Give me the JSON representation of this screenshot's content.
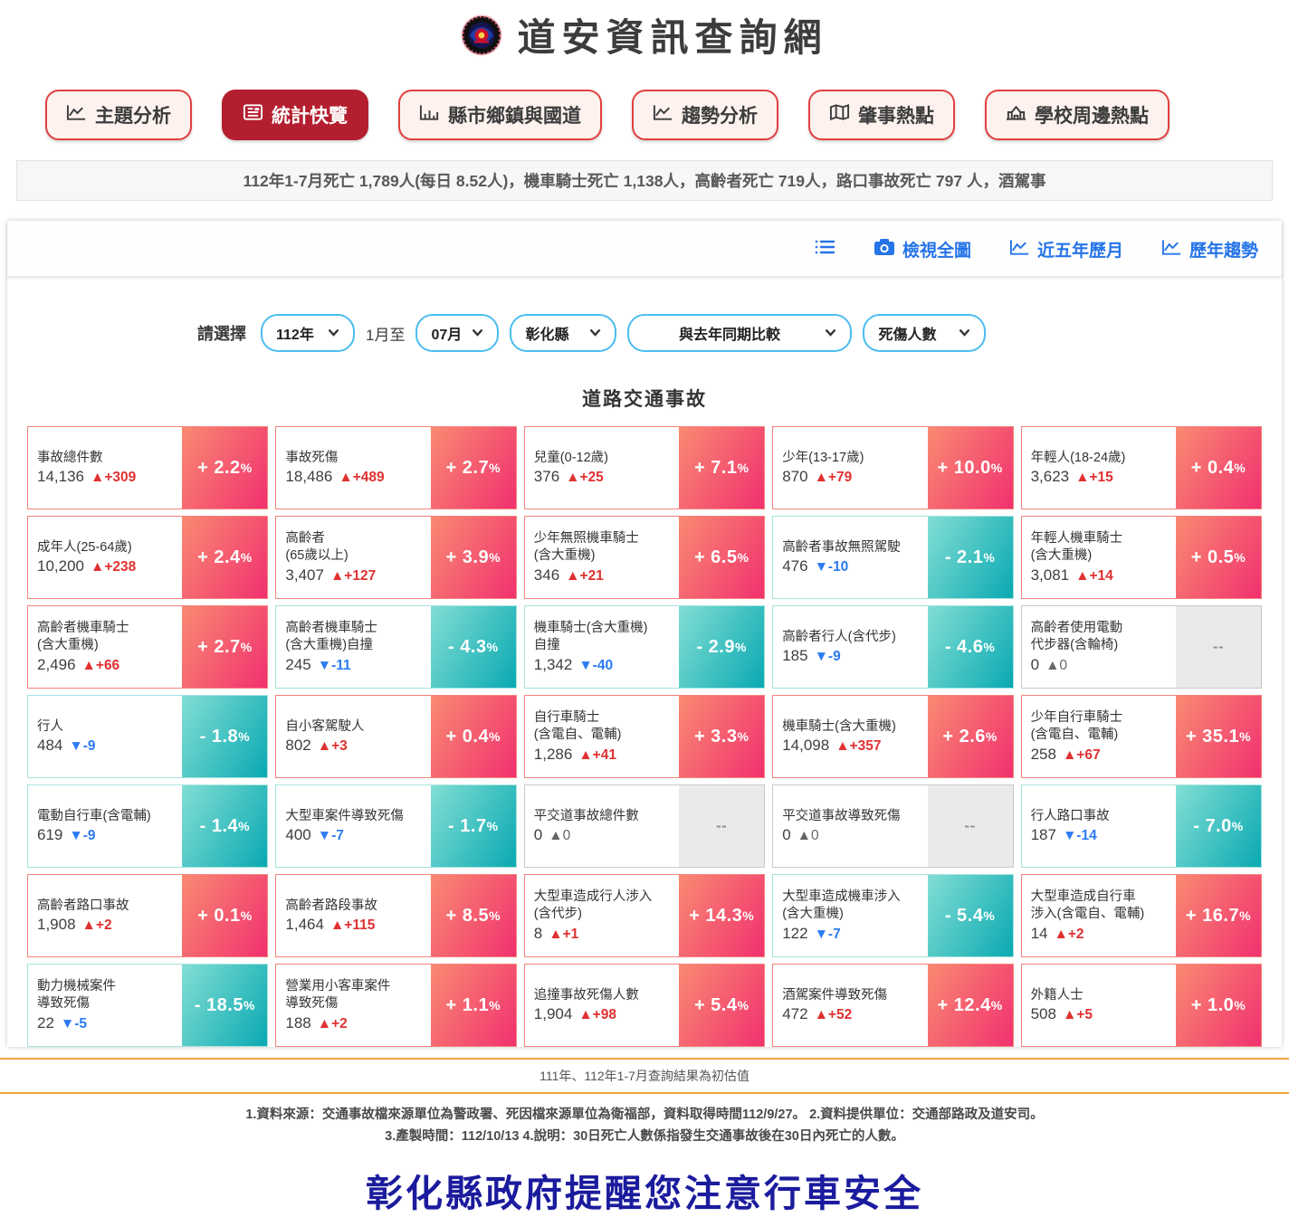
{
  "header": {
    "title": "道安資訊查詢網",
    "logo": "motc-emblem"
  },
  "nav": {
    "items": [
      {
        "label": "主題分析",
        "icon": "area-chart-icon",
        "active": false
      },
      {
        "label": "統計快覽",
        "icon": "newspaper-icon",
        "active": true
      },
      {
        "label": "縣市鄉鎮與國道",
        "icon": "bar-chart-icon",
        "active": false
      },
      {
        "label": "趨勢分析",
        "icon": "area-chart-icon",
        "active": false
      },
      {
        "label": "肇事熱點",
        "icon": "map-icon",
        "active": false
      },
      {
        "label": "學校周邊熱點",
        "icon": "school-icon",
        "active": false
      }
    ]
  },
  "marquee": {
    "text": "112年1-7月死亡 1,789人(每日 8.52人)，機車騎士死亡 1,138人，高齡者死亡 719人，路口事故死亡 797 人，酒駕事"
  },
  "toolbar": {
    "items": [
      {
        "label": "檢視全圖",
        "icon": "camera-icon"
      },
      {
        "label": "近五年歷月",
        "icon": "area-chart-icon"
      },
      {
        "label": "歷年趨勢",
        "icon": "area-chart-icon"
      }
    ]
  },
  "filters": {
    "prompt": "請選擇",
    "year": "112年",
    "range_join": "1月至",
    "month": "07月",
    "county": "彰化縣",
    "compare": "與去年同期比較",
    "metric": "死傷人數"
  },
  "section": {
    "title": "道路交通事故"
  },
  "cards": [
    {
      "label": "事故總件數",
      "value": "14,136",
      "delta": "▲+309",
      "trend": "up",
      "pct": "+ 2.2",
      "pct_unit": "%"
    },
    {
      "label": "事故死傷",
      "value": "18,486",
      "delta": "▲+489",
      "trend": "up",
      "pct": "+ 2.7",
      "pct_unit": "%"
    },
    {
      "label": "兒童(0-12歲)",
      "value": "376",
      "delta": "▲+25",
      "trend": "up",
      "pct": "+ 7.1",
      "pct_unit": "%"
    },
    {
      "label": "少年(13-17歲)",
      "value": "870",
      "delta": "▲+79",
      "trend": "up",
      "pct": "+ 10.0",
      "pct_unit": "%"
    },
    {
      "label": "年輕人(18-24歲)",
      "value": "3,623",
      "delta": "▲+15",
      "trend": "up",
      "pct": "+ 0.4",
      "pct_unit": "%"
    },
    {
      "label": "成年人(25-64歲)",
      "value": "10,200",
      "delta": "▲+238",
      "trend": "up",
      "pct": "+ 2.4",
      "pct_unit": "%"
    },
    {
      "label": "高齡者\n(65歲以上)",
      "value": "3,407",
      "delta": "▲+127",
      "trend": "up",
      "pct": "+ 3.9",
      "pct_unit": "%"
    },
    {
      "label": "少年無照機車騎士\n(含大重機)",
      "value": "346",
      "delta": "▲+21",
      "trend": "up",
      "pct": "+ 6.5",
      "pct_unit": "%"
    },
    {
      "label": "高齡者事故無照駕駛",
      "value": "476",
      "delta": "▼-10",
      "trend": "down",
      "pct": "- 2.1",
      "pct_unit": "%"
    },
    {
      "label": "年輕人機車騎士\n(含大重機)",
      "value": "3,081",
      "delta": "▲+14",
      "trend": "up",
      "pct": "+ 0.5",
      "pct_unit": "%"
    },
    {
      "label": "高齡者機車騎士\n(含大重機)",
      "value": "2,496",
      "delta": "▲+66",
      "trend": "up",
      "pct": "+ 2.7",
      "pct_unit": "%"
    },
    {
      "label": "高齡者機車騎士\n(含大重機)自撞",
      "value": "245",
      "delta": "▼-11",
      "trend": "down",
      "pct": "- 4.3",
      "pct_unit": "%"
    },
    {
      "label": "機車騎士(含大重機)\n自撞",
      "value": "1,342",
      "delta": "▼-40",
      "trend": "down",
      "pct": "- 2.9",
      "pct_unit": "%"
    },
    {
      "label": "高齡者行人(含代步)",
      "value": "185",
      "delta": "▼-9",
      "trend": "down",
      "pct": "- 4.6",
      "pct_unit": "%"
    },
    {
      "label": "高齡者使用電動\n代步器(含輪椅)",
      "value": "0",
      "delta": "▲0",
      "trend": "neutral",
      "pct": "--",
      "pct_unit": ""
    },
    {
      "label": "行人",
      "value": "484",
      "delta": "▼-9",
      "trend": "down",
      "pct": "- 1.8",
      "pct_unit": "%"
    },
    {
      "label": "自小客駕駛人",
      "value": "802",
      "delta": "▲+3",
      "trend": "up",
      "pct": "+ 0.4",
      "pct_unit": "%"
    },
    {
      "label": "自行車騎士\n(含電自、電輔)",
      "value": "1,286",
      "delta": "▲+41",
      "trend": "up",
      "pct": "+ 3.3",
      "pct_unit": "%"
    },
    {
      "label": "機車騎士(含大重機)",
      "value": "14,098",
      "delta": "▲+357",
      "trend": "up",
      "pct": "+ 2.6",
      "pct_unit": "%"
    },
    {
      "label": "少年自行車騎士\n(含電自、電輔)",
      "value": "258",
      "delta": "▲+67",
      "trend": "up",
      "pct": "+ 35.1",
      "pct_unit": "%"
    },
    {
      "label": "電動自行車(含電輔)",
      "value": "619",
      "delta": "▼-9",
      "trend": "down",
      "pct": "- 1.4",
      "pct_unit": "%"
    },
    {
      "label": "大型車案件導致死傷",
      "value": "400",
      "delta": "▼-7",
      "trend": "down",
      "pct": "- 1.7",
      "pct_unit": "%"
    },
    {
      "label": "平交道事故總件數",
      "value": "0",
      "delta": "▲0",
      "trend": "neutral",
      "pct": "--",
      "pct_unit": ""
    },
    {
      "label": "平交道事故導致死傷",
      "value": "0",
      "delta": "▲0",
      "trend": "neutral",
      "pct": "--",
      "pct_unit": ""
    },
    {
      "label": "行人路口事故",
      "value": "187",
      "delta": "▼-14",
      "trend": "down",
      "pct": "- 7.0",
      "pct_unit": "%"
    },
    {
      "label": "高齡者路口事故",
      "value": "1,908",
      "delta": "▲+2",
      "trend": "up",
      "pct": "+ 0.1",
      "pct_unit": "%"
    },
    {
      "label": "高齡者路段事故",
      "value": "1,464",
      "delta": "▲+115",
      "trend": "up",
      "pct": "+ 8.5",
      "pct_unit": "%"
    },
    {
      "label": "大型車造成行人涉入\n(含代步)",
      "value": "8",
      "delta": "▲+1",
      "trend": "up",
      "pct": "+ 14.3",
      "pct_unit": "%"
    },
    {
      "label": "大型車造成機車涉入\n(含大重機)",
      "value": "122",
      "delta": "▼-7",
      "trend": "down",
      "pct": "- 5.4",
      "pct_unit": "%"
    },
    {
      "label": "大型車造成自行車\n涉入(含電自、電輔)",
      "value": "14",
      "delta": "▲+2",
      "trend": "up",
      "pct": "+ 16.7",
      "pct_unit": "%"
    },
    {
      "label": "動力機械案件\n導致死傷",
      "value": "22",
      "delta": "▼-5",
      "trend": "down",
      "pct": "- 18.5",
      "pct_unit": "%"
    },
    {
      "label": "營業用小客車案件\n導致死傷",
      "value": "188",
      "delta": "▲+2",
      "trend": "up",
      "pct": "+ 1.1",
      "pct_unit": "%"
    },
    {
      "label": "追撞事故死傷人數",
      "value": "1,904",
      "delta": "▲+98",
      "trend": "up",
      "pct": "+ 5.4",
      "pct_unit": "%"
    },
    {
      "label": "酒駕案件導致死傷",
      "value": "472",
      "delta": "▲+52",
      "trend": "up",
      "pct": "+ 12.4",
      "pct_unit": "%"
    },
    {
      "label": "外籍人士",
      "value": "508",
      "delta": "▲+5",
      "trend": "up",
      "pct": "+ 1.0",
      "pct_unit": "%"
    }
  ],
  "footer": {
    "estimate_note": "111年、112年1-7月查詢結果為初估值",
    "note1": "1.資料來源：交通事故檔來源單位為警政署、死因檔來源單位為衛福部，資料取得時間112/9/27。  2.資料提供單位：交通部路政及道安司。",
    "note2": "3.產製時間：112/10/13 4.說明：30日死亡人數係指發生交通事故後在30日內死亡的人數。",
    "reminder": "彰化縣政府提醒您注意行車安全"
  },
  "colors": {
    "accent_red": "#b41f2f",
    "increase_gradient_start": "#f98a72",
    "increase_gradient_end": "#f1316f",
    "decrease_gradient_start": "#82ded4",
    "decrease_gradient_end": "#0aa9b2",
    "neutral_gray": "#eaeaea",
    "delta_up_red": "#e03131",
    "delta_down_blue": "#2b7bf2",
    "toolbar_blue": "#2574e8",
    "filter_border_blue": "#4cbdf0",
    "footer_band_orange": "#f2a23c",
    "reminder_navy": "#1b1b9e"
  }
}
